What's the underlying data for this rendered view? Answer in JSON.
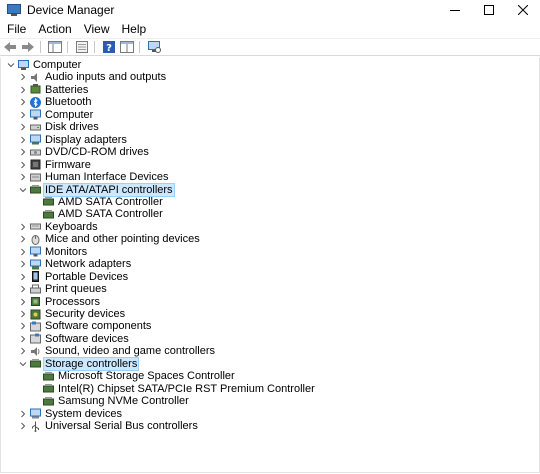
{
  "window": {
    "title": "Device Manager"
  },
  "menu": [
    "File",
    "Action",
    "View",
    "Help"
  ],
  "tree": {
    "root": "Computer",
    "categories": [
      {
        "label": "Audio inputs and outputs",
        "icon": "speaker-icon",
        "expanded": false
      },
      {
        "label": "Batteries",
        "icon": "battery-icon",
        "expanded": false
      },
      {
        "label": "Bluetooth",
        "icon": "bluetooth-icon",
        "expanded": false
      },
      {
        "label": "Computer",
        "icon": "monitor-icon",
        "expanded": false
      },
      {
        "label": "Disk drives",
        "icon": "disk-drive-icon",
        "expanded": false
      },
      {
        "label": "Display adapters",
        "icon": "display-adapter-icon",
        "expanded": false
      },
      {
        "label": "DVD/CD-ROM drives",
        "icon": "dvd-drive-icon",
        "expanded": false
      },
      {
        "label": "Firmware",
        "icon": "firmware-icon",
        "expanded": false
      },
      {
        "label": "Human Interface Devices",
        "icon": "hid-icon",
        "expanded": false
      },
      {
        "label": "IDE ATA/ATAPI controllers",
        "icon": "ide-controller-icon",
        "expanded": true,
        "selected": true,
        "children": [
          "AMD SATA Controller",
          "AMD SATA Controller"
        ]
      },
      {
        "label": "Keyboards",
        "icon": "keyboard-icon",
        "expanded": false
      },
      {
        "label": "Mice and other pointing devices",
        "icon": "mouse-icon",
        "expanded": false
      },
      {
        "label": "Monitors",
        "icon": "monitor-icon",
        "expanded": false
      },
      {
        "label": "Network adapters",
        "icon": "network-adapter-icon",
        "expanded": false
      },
      {
        "label": "Portable Devices",
        "icon": "portable-device-icon",
        "expanded": false
      },
      {
        "label": "Print queues",
        "icon": "printer-icon",
        "expanded": false
      },
      {
        "label": "Processors",
        "icon": "processor-icon",
        "expanded": false
      },
      {
        "label": "Security devices",
        "icon": "security-device-icon",
        "expanded": false
      },
      {
        "label": "Software components",
        "icon": "software-component-icon",
        "expanded": false
      },
      {
        "label": "Software devices",
        "icon": "software-device-icon",
        "expanded": false
      },
      {
        "label": "Sound, video and game controllers",
        "icon": "sound-icon",
        "expanded": false
      },
      {
        "label": "Storage controllers",
        "icon": "storage-controller-icon",
        "expanded": true,
        "selected": true,
        "children": [
          "Microsoft Storage Spaces Controller",
          "Intel(R) Chipset SATA/PCIe RST Premium Controller",
          "Samsung NVMe Controller"
        ]
      },
      {
        "label": "System devices",
        "icon": "system-device-icon",
        "expanded": false
      },
      {
        "label": "Universal Serial Bus controllers",
        "icon": "usb-icon",
        "expanded": false
      }
    ]
  }
}
